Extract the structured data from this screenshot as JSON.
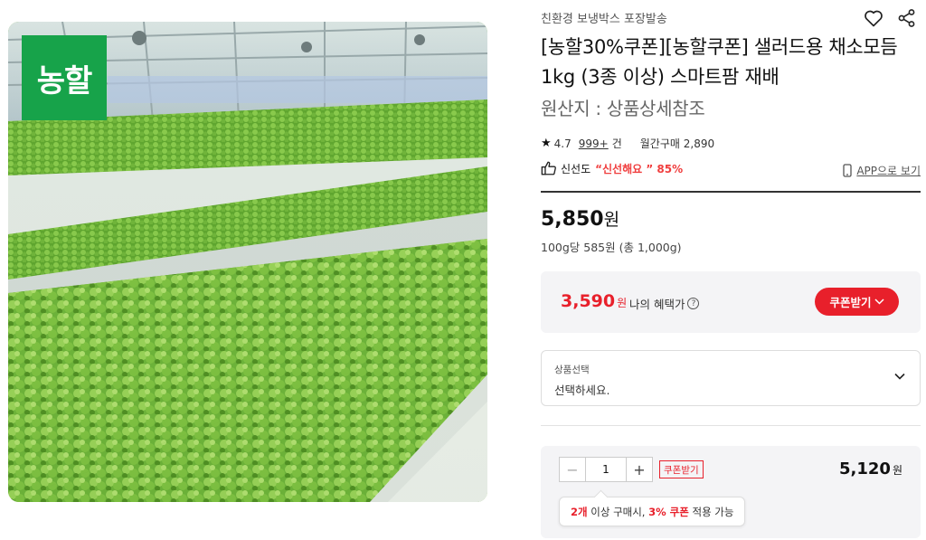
{
  "product": {
    "image_badge": "농할",
    "seller_tagline": "친환경 보냉박스 포장발송",
    "title": "[농할30%쿠폰][농할쿠폰] 샐러드용 채소모듬 1kg (3종 이상) 스마트팜 재배",
    "origin": "원산지 : 상품상세참조"
  },
  "rating": {
    "score": "4.7",
    "review_count": "999+",
    "review_unit": "건",
    "monthly_purchases": "월간구매 2,890"
  },
  "freshness": {
    "label": "신선도",
    "value": "“신선해요 ” 85%"
  },
  "app_link": "APP으로 보기",
  "price": {
    "amount": "5,850",
    "currency": "원",
    "unit_price": "100g당 585원 (총 1,000g)"
  },
  "benefit": {
    "amount": "3,590",
    "currency": "원",
    "label": "나의 혜택가",
    "help": "?",
    "coupon_button": "쿠폰받기"
  },
  "option_select": {
    "label": "상품선택",
    "value": "선택하세요."
  },
  "quantity": {
    "minus": "−",
    "value": "1",
    "plus": "+",
    "coupon_tag": "쿠폰받기",
    "total": "5,120",
    "currency": "원"
  },
  "tooltip": {
    "count": "2개",
    "text1": " 이상 구매시, ",
    "coupon": "3% 쿠폰",
    "text2": " 적용 가능"
  },
  "colors": {
    "accent_red": "#e8202b",
    "badge_green": "#17a34a"
  },
  "icons": [
    "heart-icon",
    "share-icon",
    "star-icon",
    "thumbs-up-icon",
    "phone-icon",
    "chevron-down-icon",
    "help-icon"
  ]
}
